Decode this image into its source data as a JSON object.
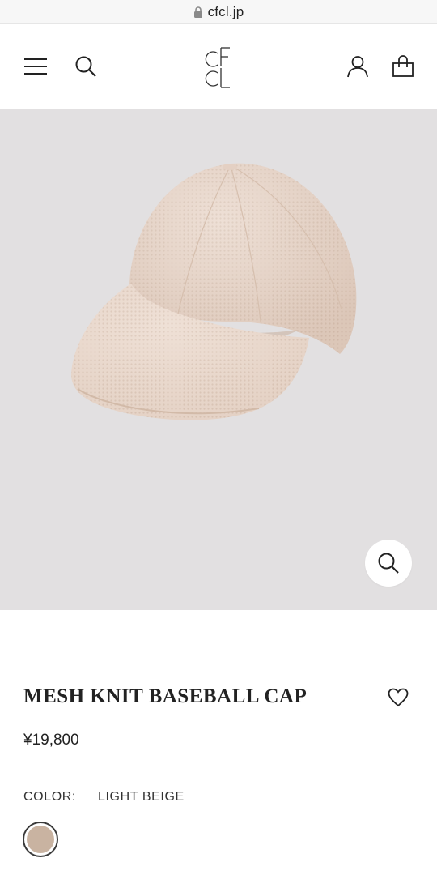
{
  "browser": {
    "url": "cfcl.jp"
  },
  "header": {
    "logo_text": "CFCL",
    "icons": {
      "menu": "hamburger-menu-icon",
      "search": "search-icon",
      "account": "user-icon",
      "bag": "shopping-bag-icon"
    }
  },
  "product": {
    "image_background": "#e2e0e1",
    "zoom_icon": "zoom-search-icon",
    "name": "MESH KNIT BASEBALL CAP",
    "favorite_icon": "heart-icon",
    "price": "¥19,800",
    "color_label": "COLOR:",
    "color_value": "LIGHT BEIGE",
    "swatches": [
      {
        "name": "LIGHT BEIGE",
        "hex": "#c9b3a1",
        "selected": true
      }
    ]
  }
}
